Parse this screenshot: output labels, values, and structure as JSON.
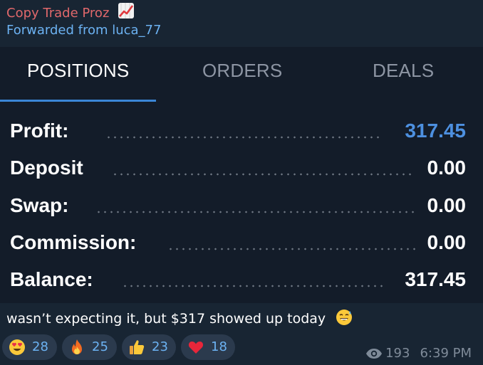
{
  "header": {
    "channel_name": "Copy Trade Proz",
    "channel_icon": "chart-increasing-icon",
    "forwarded_text": "Forwarded from luca_77"
  },
  "tabs": [
    {
      "label": "POSITIONS",
      "active": true
    },
    {
      "label": "ORDERS",
      "active": false
    },
    {
      "label": "DEALS",
      "active": false
    }
  ],
  "summary": {
    "rows": [
      {
        "label": "Profit:",
        "value": "317.45"
      },
      {
        "label": "Deposit",
        "value": "0.00"
      },
      {
        "label": "Swap:",
        "value": "0.00"
      },
      {
        "label": "Commission:",
        "value": "0.00"
      },
      {
        "label": "Balance:",
        "value": "317.45"
      }
    ]
  },
  "caption": {
    "text": "wasn’t expecting it, but $317 showed up today",
    "emoji": "sweat-smile-icon"
  },
  "reactions": [
    {
      "icon": "heart-eyes-icon",
      "count": "28"
    },
    {
      "icon": "fire-icon",
      "count": "25"
    },
    {
      "icon": "thumbs-up-icon",
      "count": "23"
    },
    {
      "icon": "heart-icon",
      "count": "18"
    }
  ],
  "meta": {
    "views": "193",
    "time": "6:39 PM"
  },
  "colors": {
    "accent": "#4d90e0",
    "channel_name": "#e0686b",
    "link": "#6cb2f2",
    "background": "#182533"
  }
}
